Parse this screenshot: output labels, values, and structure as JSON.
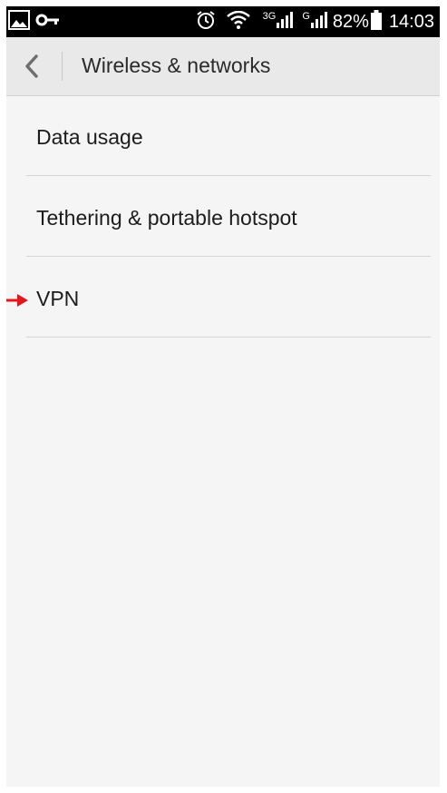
{
  "status_bar": {
    "network_3g": "3G",
    "network_g": "G",
    "battery": "82%",
    "time": "14:03",
    "icons": [
      "gallery-icon",
      "vpn-key-icon",
      "alarm-icon",
      "wifi-icon",
      "signal-icon",
      "battery-icon"
    ]
  },
  "action_bar": {
    "title": "Wireless & networks",
    "back_icon": "chevron-left-icon"
  },
  "settings": {
    "items": [
      {
        "label": "Data usage"
      },
      {
        "label": "Tethering & portable hotspot"
      },
      {
        "label": "VPN"
      }
    ]
  },
  "colors": {
    "status_bar": "#000000",
    "action_bar": "#e9e9e9",
    "background": "#f5f5f5",
    "divider": "#d5d5d5",
    "annotation_arrow": "#e8141b"
  }
}
